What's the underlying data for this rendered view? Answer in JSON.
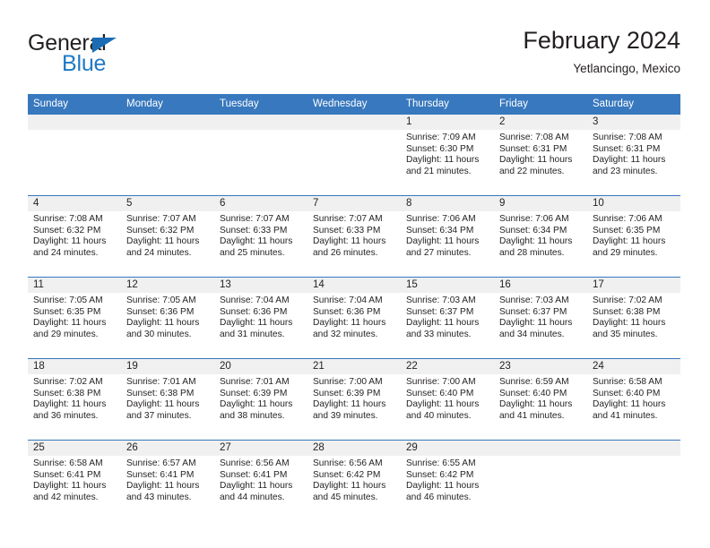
{
  "logo": {
    "word_top": "General",
    "word_bottom": "Blue",
    "triangle_icon": "triangle-icon",
    "color_dark": "#231f20",
    "color_blue": "#2079c4"
  },
  "header": {
    "title": "February 2024",
    "subtitle": "Yetlancingo, Mexico"
  },
  "theme": {
    "header_row_bg": "#3878be",
    "daynum_band_bg": "#f0f0f0",
    "cell_bg": "#ffffff",
    "text": "#231f20"
  },
  "weekdays": [
    "Sunday",
    "Monday",
    "Tuesday",
    "Wednesday",
    "Thursday",
    "Friday",
    "Saturday"
  ],
  "labels": {
    "sunrise_prefix": "Sunrise:",
    "sunset_prefix": "Sunset:",
    "daylight_prefix": "Daylight:"
  },
  "weeks": [
    [
      {
        "day": "",
        "empty": true
      },
      {
        "day": "",
        "empty": true
      },
      {
        "day": "",
        "empty": true
      },
      {
        "day": "",
        "empty": true
      },
      {
        "day": "1",
        "line1": "Sunrise: 7:09 AM",
        "line2": "Sunset: 6:30 PM",
        "line3": "Daylight: 11 hours",
        "line4": "and 21 minutes."
      },
      {
        "day": "2",
        "line1": "Sunrise: 7:08 AM",
        "line2": "Sunset: 6:31 PM",
        "line3": "Daylight: 11 hours",
        "line4": "and 22 minutes."
      },
      {
        "day": "3",
        "line1": "Sunrise: 7:08 AM",
        "line2": "Sunset: 6:31 PM",
        "line3": "Daylight: 11 hours",
        "line4": "and 23 minutes."
      }
    ],
    [
      {
        "day": "4",
        "line1": "Sunrise: 7:08 AM",
        "line2": "Sunset: 6:32 PM",
        "line3": "Daylight: 11 hours",
        "line4": "and 24 minutes."
      },
      {
        "day": "5",
        "line1": "Sunrise: 7:07 AM",
        "line2": "Sunset: 6:32 PM",
        "line3": "Daylight: 11 hours",
        "line4": "and 24 minutes."
      },
      {
        "day": "6",
        "line1": "Sunrise: 7:07 AM",
        "line2": "Sunset: 6:33 PM",
        "line3": "Daylight: 11 hours",
        "line4": "and 25 minutes."
      },
      {
        "day": "7",
        "line1": "Sunrise: 7:07 AM",
        "line2": "Sunset: 6:33 PM",
        "line3": "Daylight: 11 hours",
        "line4": "and 26 minutes."
      },
      {
        "day": "8",
        "line1": "Sunrise: 7:06 AM",
        "line2": "Sunset: 6:34 PM",
        "line3": "Daylight: 11 hours",
        "line4": "and 27 minutes."
      },
      {
        "day": "9",
        "line1": "Sunrise: 7:06 AM",
        "line2": "Sunset: 6:34 PM",
        "line3": "Daylight: 11 hours",
        "line4": "and 28 minutes."
      },
      {
        "day": "10",
        "line1": "Sunrise: 7:06 AM",
        "line2": "Sunset: 6:35 PM",
        "line3": "Daylight: 11 hours",
        "line4": "and 29 minutes."
      }
    ],
    [
      {
        "day": "11",
        "line1": "Sunrise: 7:05 AM",
        "line2": "Sunset: 6:35 PM",
        "line3": "Daylight: 11 hours",
        "line4": "and 29 minutes."
      },
      {
        "day": "12",
        "line1": "Sunrise: 7:05 AM",
        "line2": "Sunset: 6:36 PM",
        "line3": "Daylight: 11 hours",
        "line4": "and 30 minutes."
      },
      {
        "day": "13",
        "line1": "Sunrise: 7:04 AM",
        "line2": "Sunset: 6:36 PM",
        "line3": "Daylight: 11 hours",
        "line4": "and 31 minutes."
      },
      {
        "day": "14",
        "line1": "Sunrise: 7:04 AM",
        "line2": "Sunset: 6:36 PM",
        "line3": "Daylight: 11 hours",
        "line4": "and 32 minutes."
      },
      {
        "day": "15",
        "line1": "Sunrise: 7:03 AM",
        "line2": "Sunset: 6:37 PM",
        "line3": "Daylight: 11 hours",
        "line4": "and 33 minutes."
      },
      {
        "day": "16",
        "line1": "Sunrise: 7:03 AM",
        "line2": "Sunset: 6:37 PM",
        "line3": "Daylight: 11 hours",
        "line4": "and 34 minutes."
      },
      {
        "day": "17",
        "line1": "Sunrise: 7:02 AM",
        "line2": "Sunset: 6:38 PM",
        "line3": "Daylight: 11 hours",
        "line4": "and 35 minutes."
      }
    ],
    [
      {
        "day": "18",
        "line1": "Sunrise: 7:02 AM",
        "line2": "Sunset: 6:38 PM",
        "line3": "Daylight: 11 hours",
        "line4": "and 36 minutes."
      },
      {
        "day": "19",
        "line1": "Sunrise: 7:01 AM",
        "line2": "Sunset: 6:38 PM",
        "line3": "Daylight: 11 hours",
        "line4": "and 37 minutes."
      },
      {
        "day": "20",
        "line1": "Sunrise: 7:01 AM",
        "line2": "Sunset: 6:39 PM",
        "line3": "Daylight: 11 hours",
        "line4": "and 38 minutes."
      },
      {
        "day": "21",
        "line1": "Sunrise: 7:00 AM",
        "line2": "Sunset: 6:39 PM",
        "line3": "Daylight: 11 hours",
        "line4": "and 39 minutes."
      },
      {
        "day": "22",
        "line1": "Sunrise: 7:00 AM",
        "line2": "Sunset: 6:40 PM",
        "line3": "Daylight: 11 hours",
        "line4": "and 40 minutes."
      },
      {
        "day": "23",
        "line1": "Sunrise: 6:59 AM",
        "line2": "Sunset: 6:40 PM",
        "line3": "Daylight: 11 hours",
        "line4": "and 41 minutes."
      },
      {
        "day": "24",
        "line1": "Sunrise: 6:58 AM",
        "line2": "Sunset: 6:40 PM",
        "line3": "Daylight: 11 hours",
        "line4": "and 41 minutes."
      }
    ],
    [
      {
        "day": "25",
        "line1": "Sunrise: 6:58 AM",
        "line2": "Sunset: 6:41 PM",
        "line3": "Daylight: 11 hours",
        "line4": "and 42 minutes."
      },
      {
        "day": "26",
        "line1": "Sunrise: 6:57 AM",
        "line2": "Sunset: 6:41 PM",
        "line3": "Daylight: 11 hours",
        "line4": "and 43 minutes."
      },
      {
        "day": "27",
        "line1": "Sunrise: 6:56 AM",
        "line2": "Sunset: 6:41 PM",
        "line3": "Daylight: 11 hours",
        "line4": "and 44 minutes."
      },
      {
        "day": "28",
        "line1": "Sunrise: 6:56 AM",
        "line2": "Sunset: 6:42 PM",
        "line3": "Daylight: 11 hours",
        "line4": "and 45 minutes."
      },
      {
        "day": "29",
        "line1": "Sunrise: 6:55 AM",
        "line2": "Sunset: 6:42 PM",
        "line3": "Daylight: 11 hours",
        "line4": "and 46 minutes."
      },
      {
        "day": "",
        "empty": true
      },
      {
        "day": "",
        "empty": true
      }
    ]
  ]
}
